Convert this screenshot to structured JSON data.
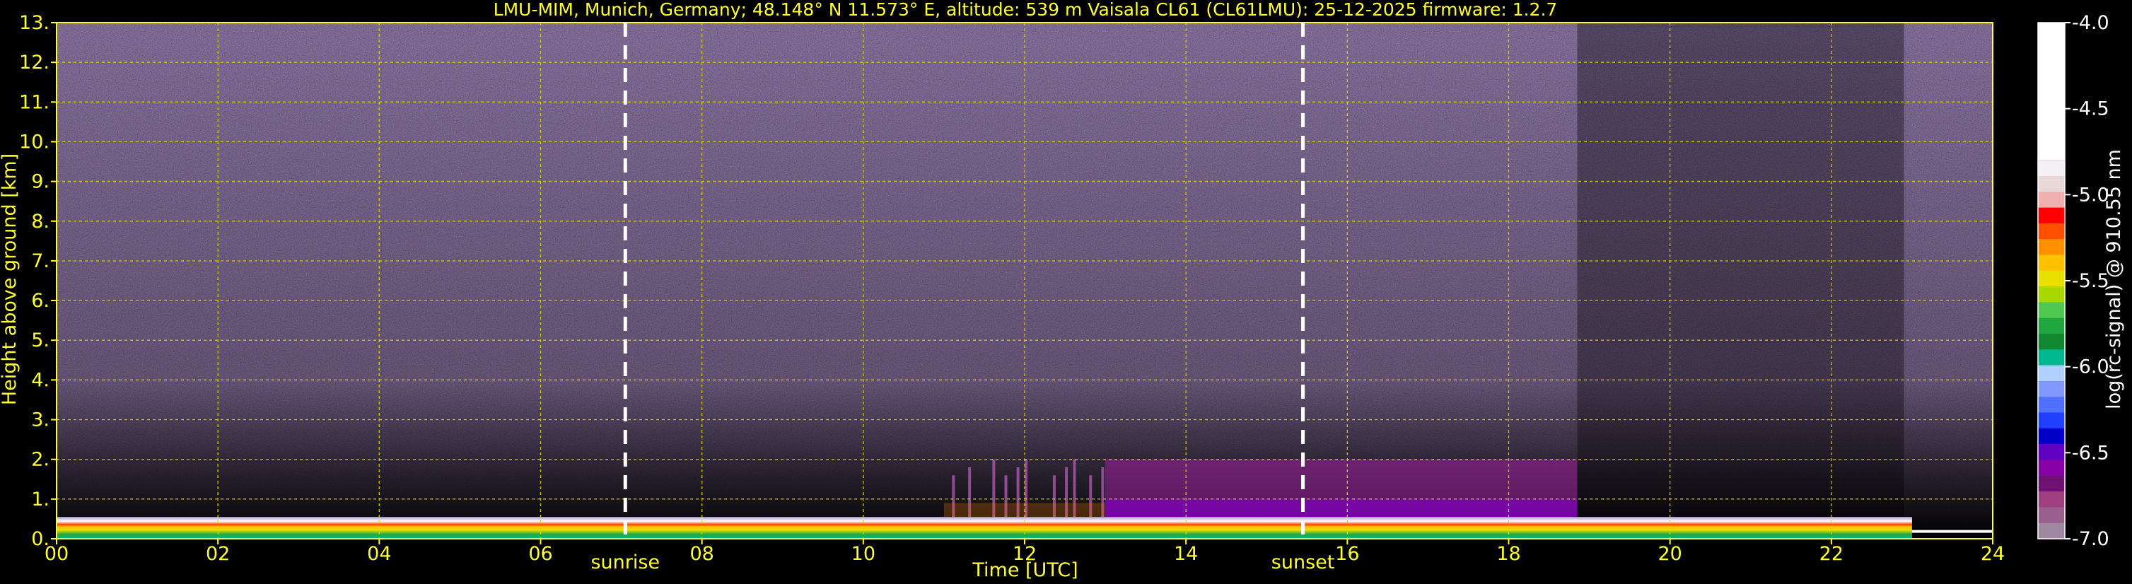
{
  "chart_data": {
    "type": "heatmap",
    "title": "LMU-MIM, Munich, Germany; 48.148° N 11.573° E, altitude: 539 m    Vaisala CL61 (CL61LMU): 25-12-2025    firmware: 1.2.7",
    "xlabel": "Time [UTC]",
    "ylabel": "Height above ground [km]",
    "xlim": [
      0,
      24
    ],
    "ylim": [
      0,
      13
    ],
    "x_ticks": [
      "00",
      "02",
      "04",
      "06",
      "08",
      "10",
      "12",
      "14",
      "16",
      "18",
      "20",
      "22",
      "24"
    ],
    "y_ticks": [
      "0.",
      "1.",
      "2.",
      "3.",
      "4.",
      "5.",
      "6.",
      "7.",
      "8.",
      "9.",
      "10.",
      "11.",
      "12.",
      "13."
    ],
    "grid": true,
    "annotations": [
      {
        "label": "sunrise",
        "x": 7.05
      },
      {
        "label": "sunset",
        "x": 15.45
      }
    ],
    "colorbar": {
      "label": "log(rc-signal) @ 910.55 nm",
      "ticks": [
        "-4.0",
        "-4.5",
        "-5.0",
        "-5.5",
        "-6.0",
        "-6.5",
        "-7.0"
      ],
      "range": [
        -7.0,
        -4.0
      ],
      "colors": [
        "#f5f0f5",
        "#e8d8d8",
        "#f0b0b0",
        "#ff0000",
        "#ff5000",
        "#ff9000",
        "#ffc000",
        "#e8e000",
        "#a8d800",
        "#50c850",
        "#20a840",
        "#108830",
        "#00b890",
        "#b0d0ff",
        "#8098ff",
        "#5070ff",
        "#2040ff",
        "#0000c8",
        "#6000c0",
        "#8800a8",
        "#701070",
        "#a04080",
        "#9a6090",
        "#a088a0"
      ]
    },
    "profile_features": [
      {
        "name": "surface aerosol layer",
        "x_range": [
          0,
          23
        ],
        "top_km": 0.55
      },
      {
        "name": "elevated layer",
        "x_range": [
          13,
          18.85
        ],
        "top_km": 2.0
      },
      {
        "name": "sparse cloud echoes",
        "x_range": [
          11,
          13
        ],
        "top_km": 2.1
      }
    ]
  }
}
